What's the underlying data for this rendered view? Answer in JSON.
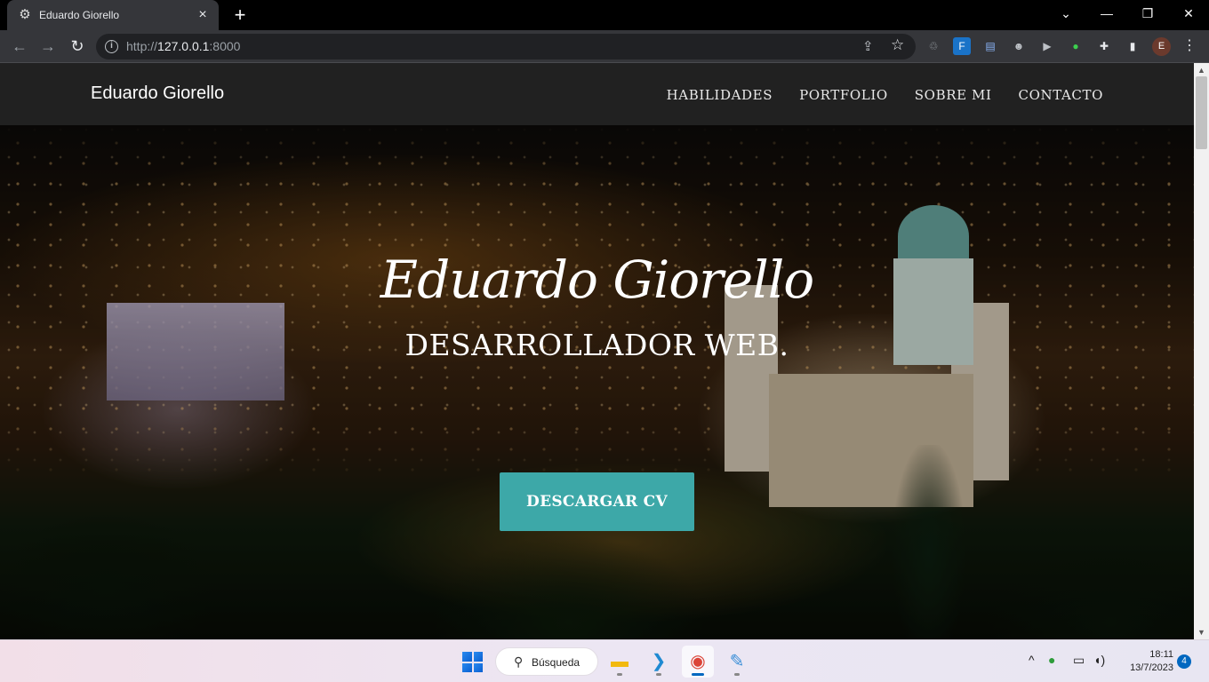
{
  "browser": {
    "tab_title": "Eduardo Giorello",
    "tab_favicon": "gear-icon",
    "new_tab": "+",
    "url_host": "http://",
    "url_bold": "127.0.0.1",
    "url_port": ":8000",
    "window_minimize": "—",
    "window_restore": "❐",
    "window_close": "✕",
    "tab_search": "⌄",
    "profile_initial": "E"
  },
  "site": {
    "brand": "Eduardo Giorello",
    "nav": [
      "HABILIDADES",
      "PORTFOLIO",
      "SOBRE MI",
      "CONTACTO"
    ],
    "hero_name": "Eduardo Giorello",
    "hero_subtitle": "DESARROLLADOR WEB.",
    "cta_label": "DESCARGAR CV",
    "accent_color": "#3da8a8"
  },
  "taskbar": {
    "search_label": "Búsqueda",
    "time": "18:11",
    "date": "13/7/2023",
    "notifications": "4"
  }
}
